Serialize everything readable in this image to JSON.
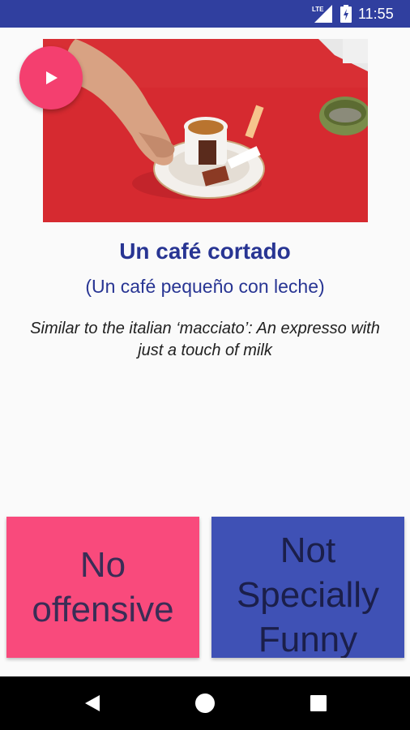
{
  "status_bar": {
    "network": "LTE",
    "time": "11:55",
    "background_color": "#303f9f"
  },
  "media": {
    "play_icon": "play-icon",
    "play_button_color": "#f43f6f"
  },
  "phrase": {
    "title": "Un café cortado",
    "translation": "(Un café pequeño con leche)",
    "description": "Similar to the italian ‘macciato’: An expresso with just a touch of milk"
  },
  "answers": {
    "left_label": "No offensive",
    "left_color": "#f94a7c",
    "right_label": "Not Specially Funny",
    "right_color": "#3f51b5"
  },
  "nav_bar": {
    "back_icon": "back-icon",
    "home_icon": "home-icon",
    "recents_icon": "recents-icon"
  }
}
